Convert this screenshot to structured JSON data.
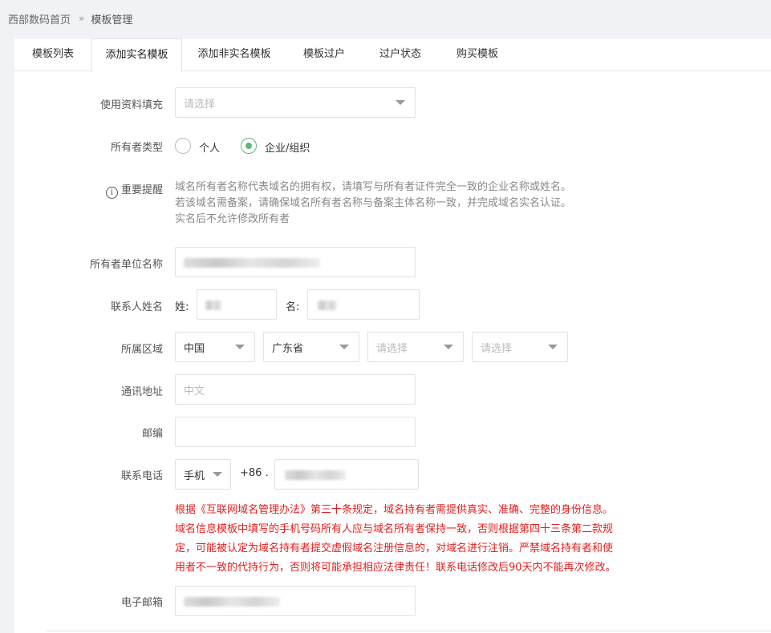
{
  "breadcrumb": {
    "home": "西部数码首页",
    "current": "模板管理"
  },
  "tabs": [
    {
      "label": "模板列表"
    },
    {
      "label": "添加实名模板",
      "active": true
    },
    {
      "label": "添加非实名模板"
    },
    {
      "label": "模板过户"
    },
    {
      "label": "过户状态"
    },
    {
      "label": "购买模板"
    }
  ],
  "form": {
    "fill_from": {
      "label": "使用资料填充",
      "placeholder": "请选择"
    },
    "owner_type": {
      "label": "所有者类型",
      "options": [
        "个人",
        "企业/组织"
      ],
      "selected": "企业/组织"
    },
    "notice": {
      "label": "重要提醒",
      "icon": "info-icon",
      "lines": [
        "域名所有者名称代表域名的拥有权，请填写与所有者证件完全一致的企业名称或姓名。",
        "若该域名需备案，请确保域名所有者名称与备案主体名称一致，并完成域名实名认证。",
        "实名后不允许修改所有者"
      ]
    },
    "org_name": {
      "label": "所有者单位名称"
    },
    "contact_name": {
      "label": "联系人姓名",
      "surname_prefix": "姓:",
      "given_prefix": "名:"
    },
    "region": {
      "label": "所属区域",
      "country": "中国",
      "province": "广东省",
      "city_placeholder": "请选择",
      "district_placeholder": "请选择"
    },
    "address": {
      "label": "通讯地址",
      "placeholder": "中文"
    },
    "zip": {
      "label": "邮编"
    },
    "phone": {
      "label": "联系电话",
      "type": "手机",
      "country_code": "+86 ."
    },
    "phone_warning": [
      "根据《互联网域名管理办法》第三十条规定，域名持有者需提供真实、准确、完整的身份信息。",
      "域名信息模板中填写的手机号码所有人应与域名所有者保持一致，否则根据第四十三条第二款规",
      "定，可能被认定为域名持有者提交虚假域名注册信息的，对域名进行注销。严禁域名持有者和使",
      "用者不一致的代持行为，否则将可能承担相应法律责任！联系电话修改后90天内不能再次修改。"
    ],
    "email": {
      "label": "电子邮箱"
    }
  },
  "colors": {
    "accent": "#5fb878",
    "warning": "#e02020"
  }
}
